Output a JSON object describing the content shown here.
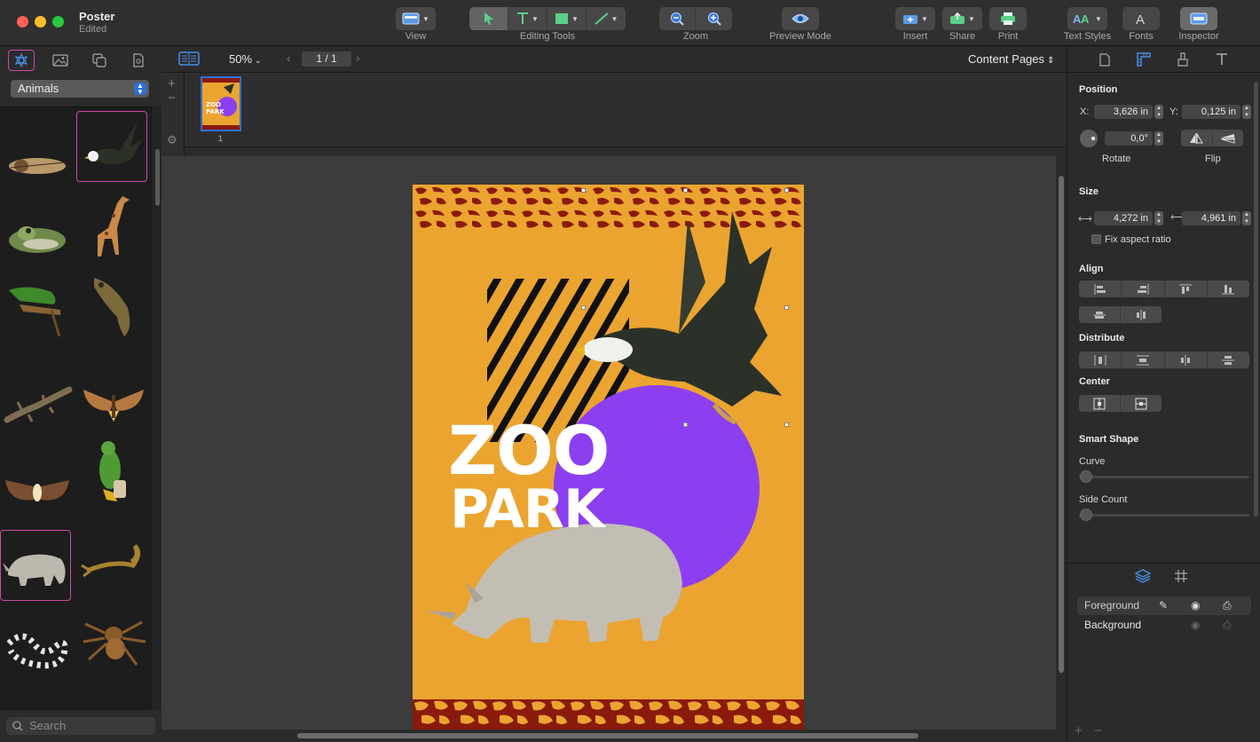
{
  "window": {
    "title": "Poster",
    "subtitle": "Edited"
  },
  "toolbar": {
    "view": "View",
    "editing_tools": "Editing Tools",
    "zoom": "Zoom",
    "preview_mode": "Preview Mode",
    "insert": "Insert",
    "share": "Share",
    "print": "Print",
    "text_styles": "Text Styles",
    "fonts": "Fonts",
    "inspector": "Inspector"
  },
  "library": {
    "category": "Animals",
    "search_placeholder": "Search"
  },
  "canvas": {
    "zoom_level": "50%",
    "page_field": "1 / 1",
    "content_pages": "Content Pages",
    "thumbnail_number": "1"
  },
  "poster": {
    "line1": "ZOO",
    "line2": "PARK"
  },
  "inspector": {
    "position_title": "Position",
    "x_label": "X:",
    "x_value": "3,626 in",
    "y_label": "Y:",
    "y_value": "0,125 in",
    "rotate_value": "0,0°",
    "rotate_label": "Rotate",
    "flip_label": "Flip",
    "size_title": "Size",
    "width_value": "4,272 in",
    "height_value": "4,961 in",
    "fix_aspect": "Fix aspect ratio",
    "align_title": "Align",
    "distribute_title": "Distribute",
    "center_title": "Center",
    "smart_shape_title": "Smart Shape",
    "curve_label": "Curve",
    "side_count_label": "Side Count"
  },
  "layers": [
    {
      "name": "Foreground"
    },
    {
      "name": "Background"
    }
  ],
  "colors": {
    "accent": "#2f6ed8",
    "selection": "#d04aa5",
    "poster_bg": "#eba430",
    "circle": "#8c3ff0",
    "leopard": "#8a1a0c"
  }
}
